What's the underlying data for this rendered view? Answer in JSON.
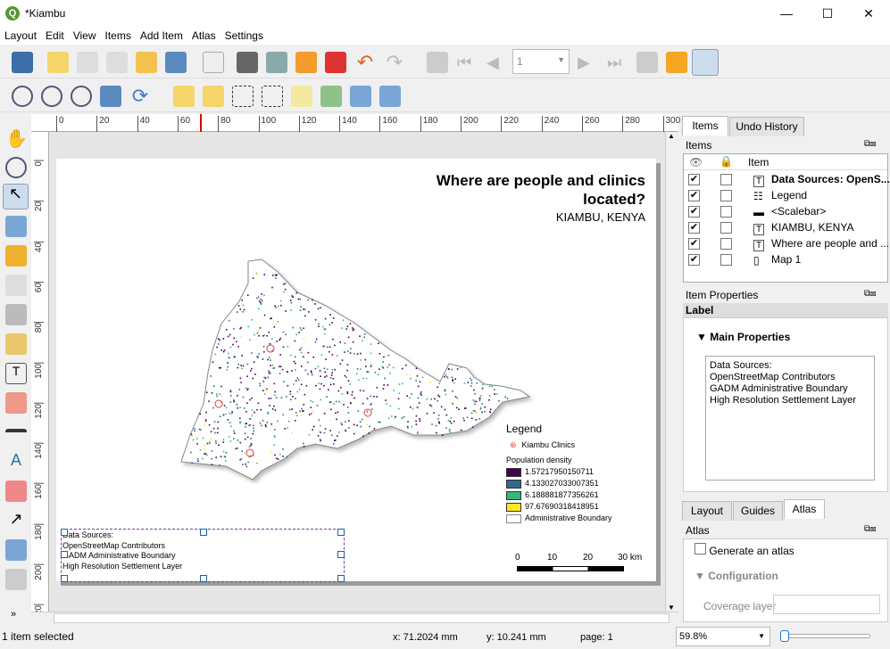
{
  "window": {
    "title": "*Kiambu",
    "minimize": "—",
    "maximize": "☐",
    "close": "✕"
  },
  "menu": [
    "Layout",
    "Edit",
    "View",
    "Items",
    "Add Item",
    "Atlas",
    "Settings"
  ],
  "toolbar": {
    "page_number": "1"
  },
  "rulers": {
    "h": [
      "0",
      "20",
      "40",
      "60",
      "80",
      "100",
      "120",
      "140",
      "160",
      "180",
      "200",
      "220",
      "240",
      "260",
      "280",
      "300"
    ],
    "v": [
      "0",
      "20",
      "40",
      "60",
      "80",
      "100",
      "120",
      "140",
      "160",
      "180",
      "200",
      "220"
    ]
  },
  "layout": {
    "title": "Where are people and clinics located?",
    "subtitle": "KIAMBU, KENYA",
    "legend": {
      "title": "Legend",
      "clinics": "Kiambu Clinics",
      "group": "Population density",
      "classes": [
        {
          "label": "1.57217950150711",
          "color": "#440154"
        },
        {
          "label": "4.133027033007351",
          "color": "#31688e"
        },
        {
          "label": "6.188881877356261",
          "color": "#35b779"
        },
        {
          "label": "97.67690318418951",
          "color": "#fde725"
        }
      ],
      "boundary": "Administrative Boundary"
    },
    "scalebar": {
      "labels": [
        "0",
        "10",
        "20",
        "30 km"
      ]
    },
    "sources": [
      "Data Sources:",
      "OpenStreetMap Contributors",
      "GADM Administrative Boundary",
      "High Resolution Settlement Layer"
    ]
  },
  "panel": {
    "tabs": [
      "Items",
      "Undo History"
    ],
    "items_title": "Items",
    "columns": {
      "item": "Item"
    },
    "items": [
      {
        "label": "Data Sources: OpenS...",
        "icon": "T",
        "bold": true
      },
      {
        "label": "Legend",
        "icon": "legend"
      },
      {
        "label": "<Scalebar>",
        "icon": "scalebar"
      },
      {
        "label": "KIAMBU, KENYA",
        "icon": "T"
      },
      {
        "label": "Where are people and ...",
        "icon": "T"
      },
      {
        "label": "Map 1",
        "icon": "map"
      }
    ],
    "props_title": "Item Properties",
    "props_section": "Label",
    "main_props": "Main Properties",
    "label_text": [
      "Data Sources:",
      "OpenStreetMap Contributors",
      "GADM Administrative Boundary",
      "High Resolution Settlement Layer"
    ],
    "bottom_tabs": [
      "Layout",
      "Guides",
      "Atlas"
    ],
    "atlas_title": "Atlas",
    "generate": "Generate an atlas",
    "configuration": "Configuration",
    "coverage": "Coverage layer"
  },
  "status": {
    "selected": "1 item selected",
    "x": "x: 71.2024 mm",
    "y": "y: 10.241 mm",
    "page": "page: 1",
    "zoom": "59.8%"
  }
}
